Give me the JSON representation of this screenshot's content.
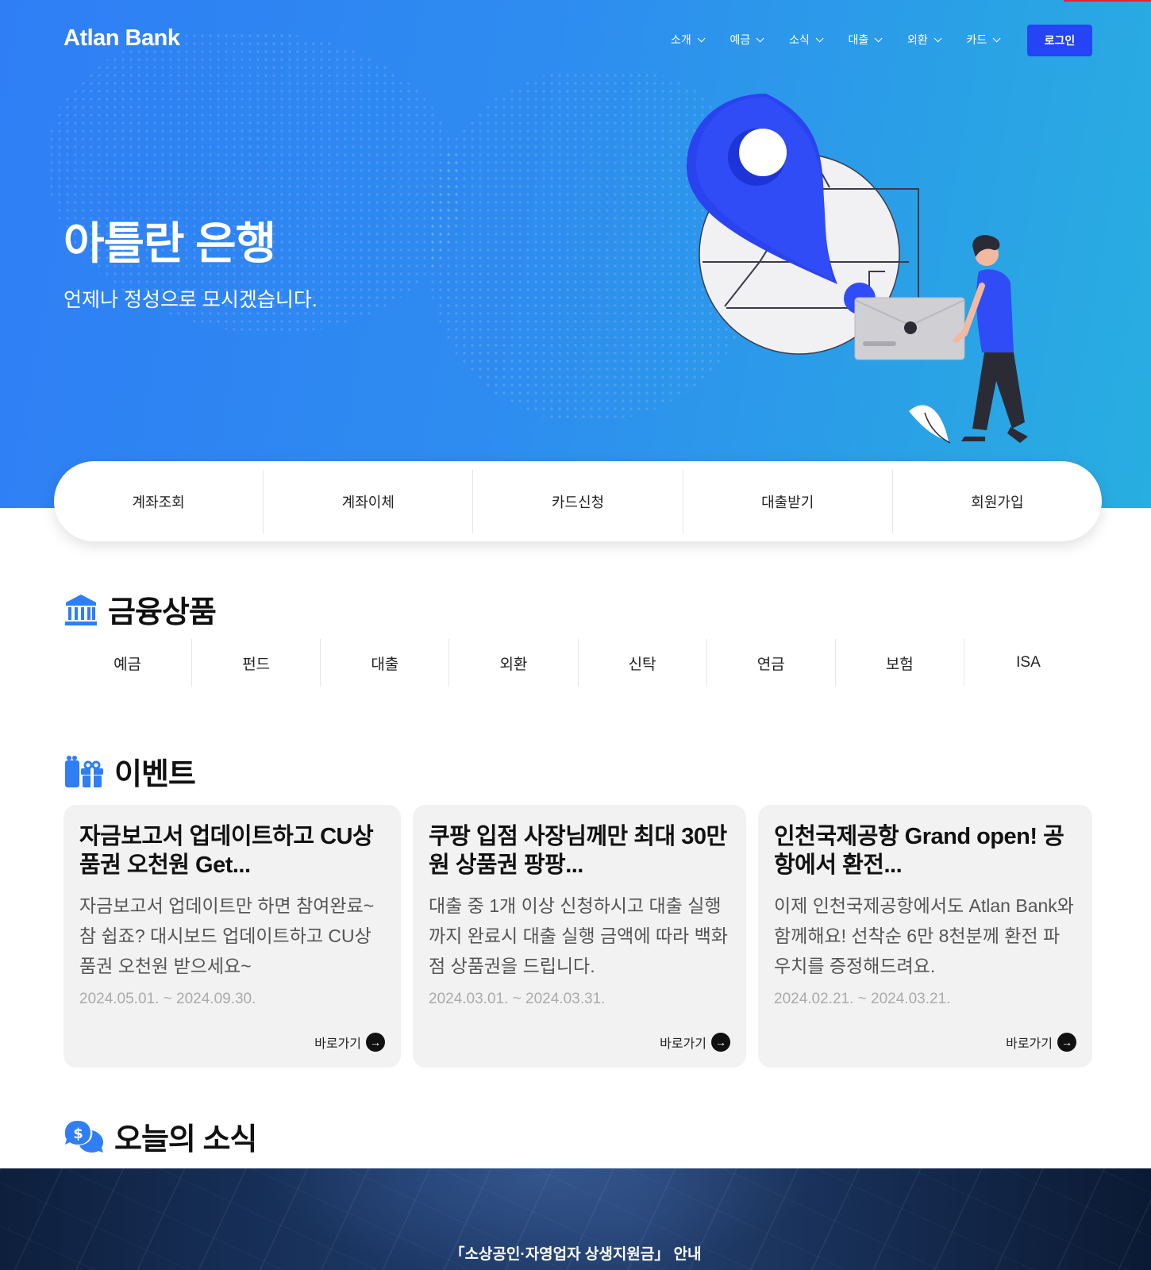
{
  "header": {
    "logo": "Atlan Bank",
    "nav": [
      "소개",
      "예금",
      "소식",
      "대출",
      "외환",
      "카드"
    ],
    "login_label": "로그인"
  },
  "hero": {
    "title": "아틀란 은행",
    "subtitle": "언제나 정성으로 모시겠습니다."
  },
  "quick_menu": [
    "계좌조회",
    "계좌이체",
    "카드신청",
    "대출받기",
    "회원가입"
  ],
  "products": {
    "title": "금융상품",
    "items": [
      "예금",
      "펀드",
      "대출",
      "외환",
      "신탁",
      "연금",
      "보험",
      "ISA"
    ]
  },
  "events": {
    "title": "이벤트",
    "cards": [
      {
        "title": "자금보고서 업데이트하고 CU상품권 오천원 Get...",
        "desc": "자금보고서 업데이트만 하면 참여완료~ 참 쉽죠? 대시보드 업데이트하고 CU상품권 오천원 받으세요~",
        "date": "2024.05.01. ~ 2024.09.30.",
        "link": "바로가기"
      },
      {
        "title": "쿠팡 입점 사장님께만 최대 30만원 상품권 팡팡...",
        "desc": "대출 중 1개 이상 신청하시고 대출 실행까지 완료시 대출 실행 금액에 따라 백화점 상품권을 드립니다.",
        "date": "2024.03.01. ~ 2024.03.31.",
        "link": "바로가기"
      },
      {
        "title": "인천국제공항 Grand open! 공항에서 환전...",
        "desc": "이제 인천국제공항에서도 Atlan Bank와 함께해요! 선착순 6만 8천분께 환전 파우치를 증정해드려요.",
        "date": "2024.02.21. ~ 2024.03.21.",
        "link": "바로가기"
      }
    ]
  },
  "news": {
    "title": "오늘의 소식",
    "banner_text": "「소상공인·자영업자 상생지원금」 안내"
  },
  "colors": {
    "hero_start": "#2f7ef5",
    "hero_end": "#28aee0",
    "login_button": "#2544f5",
    "icon_blue": "#2f7ef5",
    "card_bg": "#f2f2f2"
  }
}
